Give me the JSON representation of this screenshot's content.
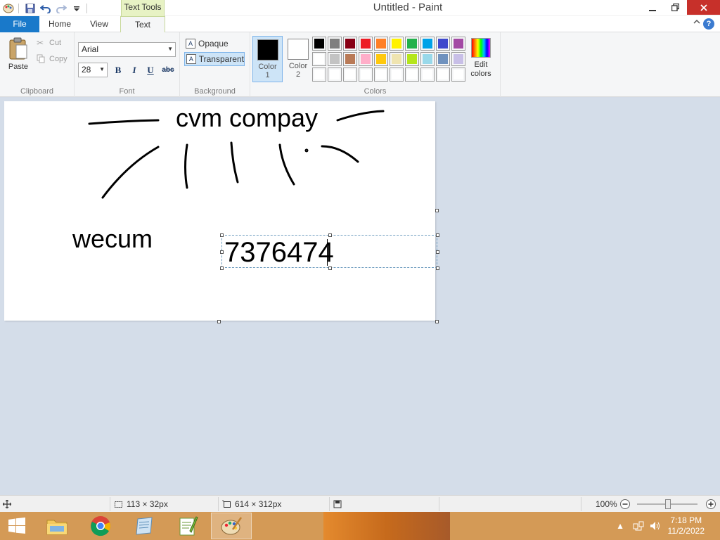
{
  "window": {
    "title": "Untitled - Paint"
  },
  "contextual_tab_group": "Text Tools",
  "ribbon_tabs": {
    "file": "File",
    "home": "Home",
    "view": "View",
    "text": "Text"
  },
  "clipboard": {
    "paste": "Paste",
    "cut": "Cut",
    "copy": "Copy",
    "group_label": "Clipboard"
  },
  "font": {
    "name": "Arial",
    "size": "28",
    "bold": "B",
    "italic": "I",
    "underline": "U",
    "strikethrough": "abc",
    "group_label": "Font"
  },
  "background": {
    "opaque": "Opaque",
    "transparent": "Transparent",
    "group_label": "Background",
    "selected": "transparent"
  },
  "colors": {
    "color1_label": "Color",
    "color1_num": "1",
    "color2_label": "Color",
    "color2_num": "2",
    "color1_value": "#000000",
    "color2_value": "#ffffff",
    "edit_colors_line1": "Edit",
    "edit_colors_line2": "colors",
    "group_label": "Colors",
    "palette": [
      "#000000",
      "#7f7f7f",
      "#880015",
      "#ed1c24",
      "#ff7f27",
      "#fff200",
      "#22b14c",
      "#00a2e8",
      "#3f48cc",
      "#a349a4",
      "#ffffff",
      "#c3c3c3",
      "#b97a57",
      "#ffaec9",
      "#ffc90e",
      "#efe4b0",
      "#b5e61d",
      "#99d9ea",
      "#7092be",
      "#c8bfe7",
      "#ffffff",
      "#ffffff",
      "#ffffff",
      "#ffffff",
      "#ffffff",
      "#ffffff",
      "#ffffff",
      "#ffffff",
      "#ffffff",
      "#ffffff"
    ]
  },
  "canvas": {
    "text_heading": "cvm compay",
    "text_left": "wecum",
    "text_active": "7376474"
  },
  "statusbar": {
    "selection_size": "113 × 32px",
    "canvas_size": "614 × 312px",
    "zoom": "100%"
  },
  "taskbar": {
    "time": "7:18 PM",
    "date": "11/2/2022"
  }
}
